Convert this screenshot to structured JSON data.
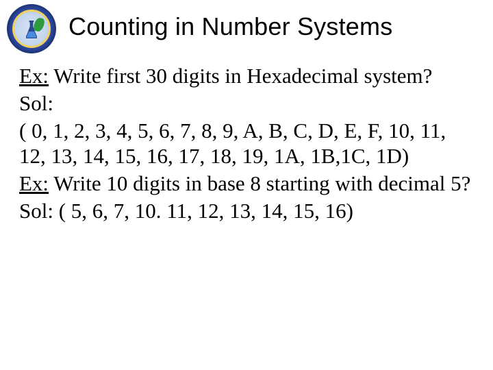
{
  "title": "Counting in Number Systems",
  "ex_label": "Ex:",
  "sol_label": "Sol:",
  "q1_text": " Write first 30 digits in Hexadecimal system?",
  "q1_answer": "( 0, 1, 2, 3, 4, 5, 6, 7, 8, 9, A, B, C, D, E, F, 10, 11, 12, 13, 14, 15, 16, 17, 18, 19, 1A, 1B,1C, 1D)",
  "q2_text": " Write 10 digits in base 8 starting with decimal 5?",
  "q2_answer_line": "Sol: ( 5, 6, 7, 10. 11, 12, 13, 14, 15, 16)"
}
